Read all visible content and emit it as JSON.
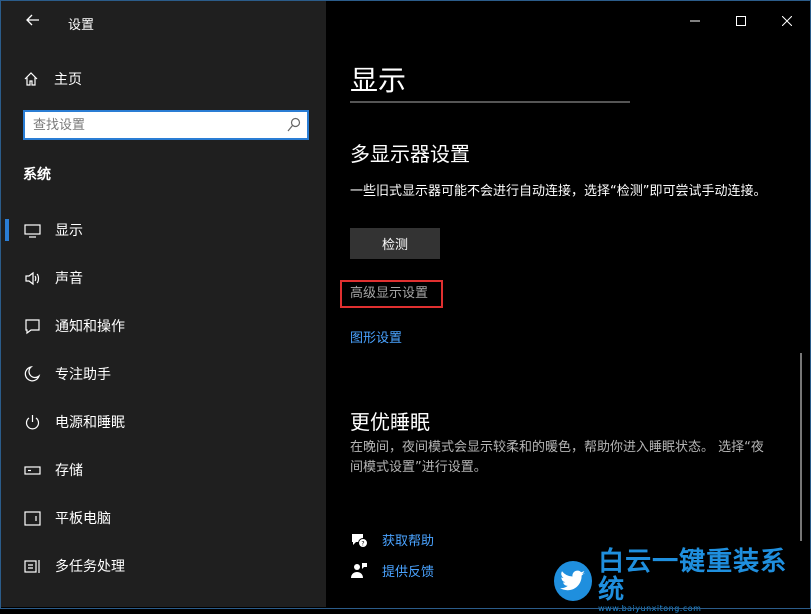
{
  "app": {
    "title": "设置"
  },
  "sidebar": {
    "home_label": "主页",
    "search_placeholder": "查找设置",
    "section_label": "系统",
    "items": [
      {
        "label": "显示",
        "icon": "monitor-icon",
        "active": true
      },
      {
        "label": "声音",
        "icon": "speaker-icon",
        "active": false
      },
      {
        "label": "通知和操作",
        "icon": "notification-icon",
        "active": false
      },
      {
        "label": "专注助手",
        "icon": "moon-icon",
        "active": false
      },
      {
        "label": "电源和睡眠",
        "icon": "power-icon",
        "active": false
      },
      {
        "label": "存储",
        "icon": "storage-icon",
        "active": false
      },
      {
        "label": "平板电脑",
        "icon": "tablet-icon",
        "active": false
      },
      {
        "label": "多任务处理",
        "icon": "multitasking-icon",
        "active": false
      }
    ]
  },
  "main": {
    "page_title": "显示",
    "multi_display": {
      "heading": "多显示器设置",
      "description": "一些旧式显示器可能不会进行自动连接，选择“检测”即可尝试手动连接。",
      "detect_button": "检测",
      "advanced_link": "高级显示设置",
      "graphics_link": "图形设置"
    },
    "sleep": {
      "heading": "更优睡眠",
      "description": "在晚间，夜间模式会显示较柔和的暖色，帮助你进入睡眠状态。 选择“夜间模式设置”进行设置。"
    },
    "help": {
      "get_help": "获取帮助",
      "feedback": "提供反馈"
    }
  },
  "watermark": {
    "brand": "白云一键重装系统",
    "url": "www.baiyunxitong.com"
  },
  "colors": {
    "accent": "#2a7dd4",
    "link": "#4aa3ff",
    "highlight_box": "#e03030",
    "sidebar_bg": "#1f1f1f"
  }
}
